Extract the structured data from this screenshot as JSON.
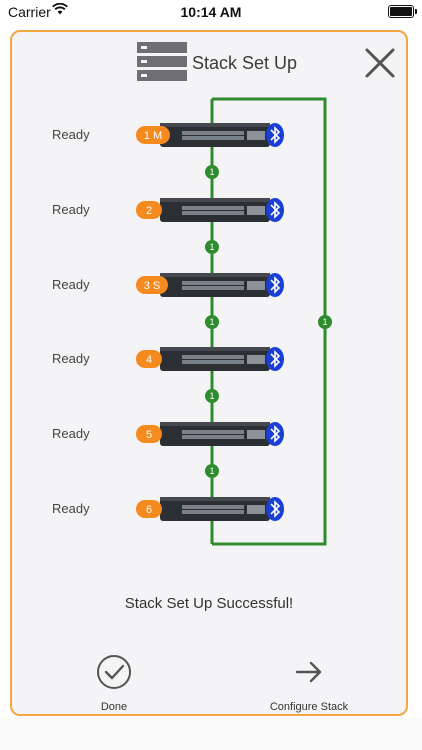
{
  "status": {
    "carrier": "Carrier",
    "time": "10:14 AM"
  },
  "modal": {
    "title": "Stack Set Up",
    "message": "Stack Set Up Successful!"
  },
  "switches": [
    {
      "status": "Ready",
      "badge": "1 M"
    },
    {
      "status": "Ready",
      "badge": "2"
    },
    {
      "status": "Ready",
      "badge": "3 S"
    },
    {
      "status": "Ready",
      "badge": "4"
    },
    {
      "status": "Ready",
      "badge": "5"
    },
    {
      "status": "Ready",
      "badge": "6"
    }
  ],
  "links": {
    "between": [
      "1",
      "1",
      "1",
      "1",
      "1"
    ],
    "ring": "1"
  },
  "actions": {
    "done": "Done",
    "configure": "Configure Stack"
  },
  "colors": {
    "accent": "#f58a1f",
    "border": "#f4a640",
    "link": "#2e8b2e",
    "bluetooth": "#1a3fd6"
  }
}
